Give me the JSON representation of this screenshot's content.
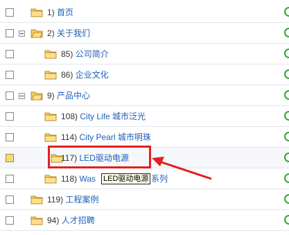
{
  "tree": {
    "rows": [
      {
        "num": "1)",
        "label": "首页"
      },
      {
        "num": "2)",
        "label": "关于我们"
      },
      {
        "num": "85)",
        "label": "公司简介"
      },
      {
        "num": "86)",
        "label": "企业文化"
      },
      {
        "num": "9)",
        "label": "产品中心"
      },
      {
        "num": "108)",
        "label": "City Life 城市泛光"
      },
      {
        "num": "114)",
        "label": "City Pearl 城市明珠"
      },
      {
        "num": "117)",
        "label": "LED驱动电源"
      },
      {
        "num": "118)",
        "label": "Was",
        "label_tail": "系列"
      },
      {
        "num": "119)",
        "label": "工程案例"
      },
      {
        "num": "94)",
        "label": "人才招聘"
      }
    ]
  },
  "tooltip": {
    "text": "LED驱动电源"
  },
  "colors": {
    "highlight": "#e12020",
    "link": "#1d5fb8",
    "selected_checkbox": "#f3dc7a"
  }
}
